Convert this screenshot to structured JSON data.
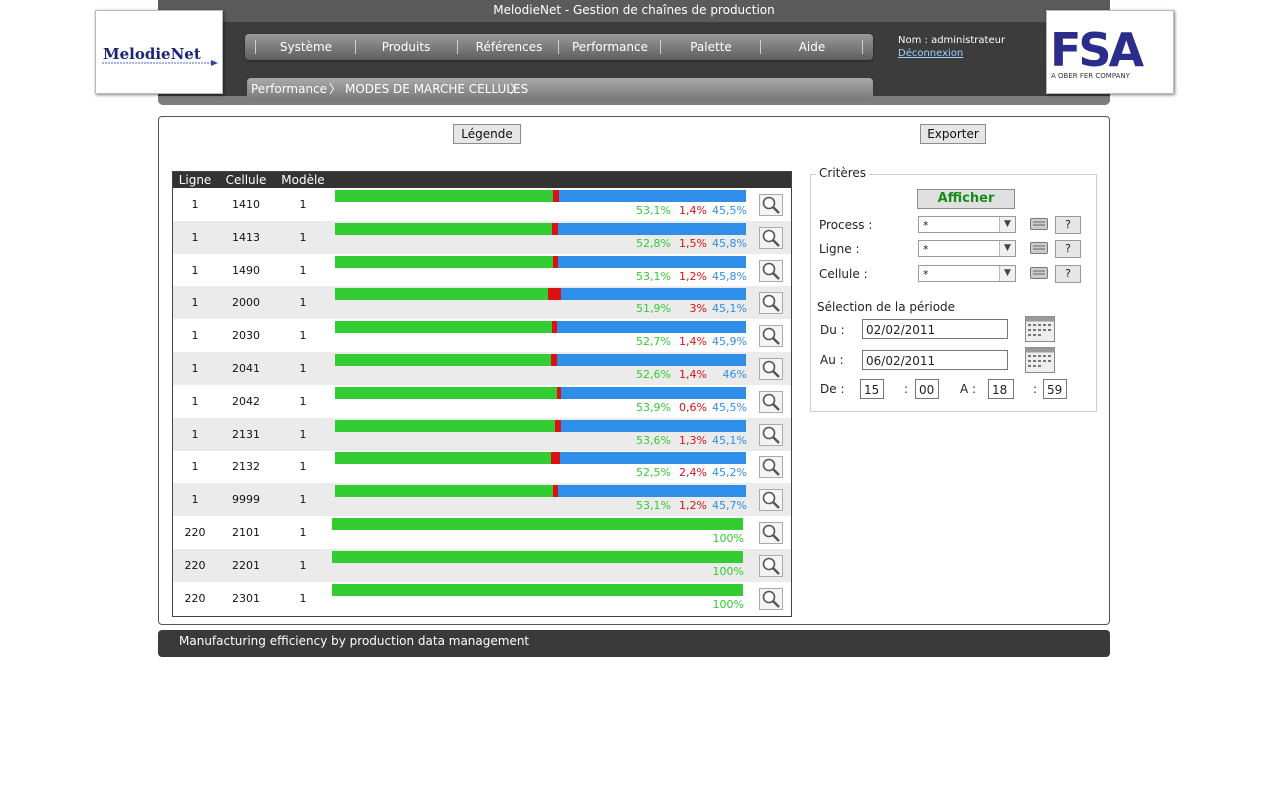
{
  "app": {
    "title": "MelodieNet - Gestion de chaînes de production",
    "logo_left_text": "MelodieNet",
    "logo_right_text": "FSA",
    "logo_right_sub": "A OBER FER COMPANY"
  },
  "nav": {
    "items": [
      "Système",
      "Produits",
      "Références",
      "Performance",
      "Palette",
      "Aide"
    ]
  },
  "breadcrumb": {
    "items": [
      "Performance",
      "MODES DE MARCHE CELLULES"
    ]
  },
  "user": {
    "label": "Nom : administrateur",
    "logout": "Déconnexion"
  },
  "toolbar": {
    "legend_label": "Légende",
    "export_label": "Exporter"
  },
  "table": {
    "headers": [
      "Ligne",
      "Cellule",
      "Modèle"
    ],
    "rows": [
      {
        "ligne": "1",
        "cellule": "1410",
        "modele": "1",
        "green": 53.1,
        "red": 1.4,
        "blue": 45.5,
        "g": "53,1%",
        "r": "1,4%",
        "b": "45,5%"
      },
      {
        "ligne": "1",
        "cellule": "1413",
        "modele": "1",
        "green": 52.8,
        "red": 1.5,
        "blue": 45.8,
        "g": "52,8%",
        "r": "1,5%",
        "b": "45,8%"
      },
      {
        "ligne": "1",
        "cellule": "1490",
        "modele": "1",
        "green": 53.1,
        "red": 1.2,
        "blue": 45.8,
        "g": "53,1%",
        "r": "1,2%",
        "b": "45,8%"
      },
      {
        "ligne": "1",
        "cellule": "2000",
        "modele": "1",
        "green": 51.9,
        "red": 3,
        "blue": 45.1,
        "g": "51,9%",
        "r": "3%",
        "b": "45,1%"
      },
      {
        "ligne": "1",
        "cellule": "2030",
        "modele": "1",
        "green": 52.7,
        "red": 1.4,
        "blue": 45.9,
        "g": "52,7%",
        "r": "1,4%",
        "b": "45,9%"
      },
      {
        "ligne": "1",
        "cellule": "2041",
        "modele": "1",
        "green": 52.6,
        "red": 1.4,
        "blue": 46,
        "g": "52,6%",
        "r": "1,4%",
        "b": "46%"
      },
      {
        "ligne": "1",
        "cellule": "2042",
        "modele": "1",
        "green": 53.9,
        "red": 0.6,
        "blue": 45.5,
        "g": "53,9%",
        "r": "0,6%",
        "b": "45,5%"
      },
      {
        "ligne": "1",
        "cellule": "2131",
        "modele": "1",
        "green": 53.6,
        "red": 1.3,
        "blue": 45.1,
        "g": "53,6%",
        "r": "1,3%",
        "b": "45,1%"
      },
      {
        "ligne": "1",
        "cellule": "2132",
        "modele": "1",
        "green": 52.5,
        "red": 2.4,
        "blue": 45.2,
        "g": "52,5%",
        "r": "2,4%",
        "b": "45,2%"
      },
      {
        "ligne": "1",
        "cellule": "9999",
        "modele": "1",
        "green": 53.1,
        "red": 1.2,
        "blue": 45.7,
        "g": "53,1%",
        "r": "1,2%",
        "b": "45,7%"
      },
      {
        "ligne": "220",
        "cellule": "2101",
        "modele": "1",
        "green": 100,
        "red": 0,
        "blue": 0,
        "g": "100%",
        "r": "",
        "b": ""
      },
      {
        "ligne": "220",
        "cellule": "2201",
        "modele": "1",
        "green": 100,
        "red": 0,
        "blue": 0,
        "g": "100%",
        "r": "",
        "b": ""
      },
      {
        "ligne": "220",
        "cellule": "2301",
        "modele": "1",
        "green": 100,
        "red": 0,
        "blue": 0,
        "g": "100%",
        "r": "",
        "b": ""
      }
    ]
  },
  "criteria": {
    "title": "Critères",
    "show_label": "Afficher",
    "process_label": "Process :",
    "ligne_label": "Ligne :",
    "cellule_label": "Cellule :",
    "process_value": "*",
    "ligne_value": "*",
    "cellule_value": "*",
    "help_label": "?",
    "period_title": "Sélection de la période",
    "du_label": "Du :",
    "au_label": "Au :",
    "du_value": "02/02/2011",
    "au_value": "06/02/2011",
    "de_label": "De :",
    "a_label": "A :",
    "colon": ":",
    "de_h": "15",
    "de_m": "00",
    "a_h": "18",
    "a_m": "59"
  },
  "footer": {
    "text": "Manufacturing efficiency by production data management"
  },
  "colors": {
    "green": "#33cc33",
    "red": "#dd1111",
    "blue": "#2f8fe8"
  }
}
